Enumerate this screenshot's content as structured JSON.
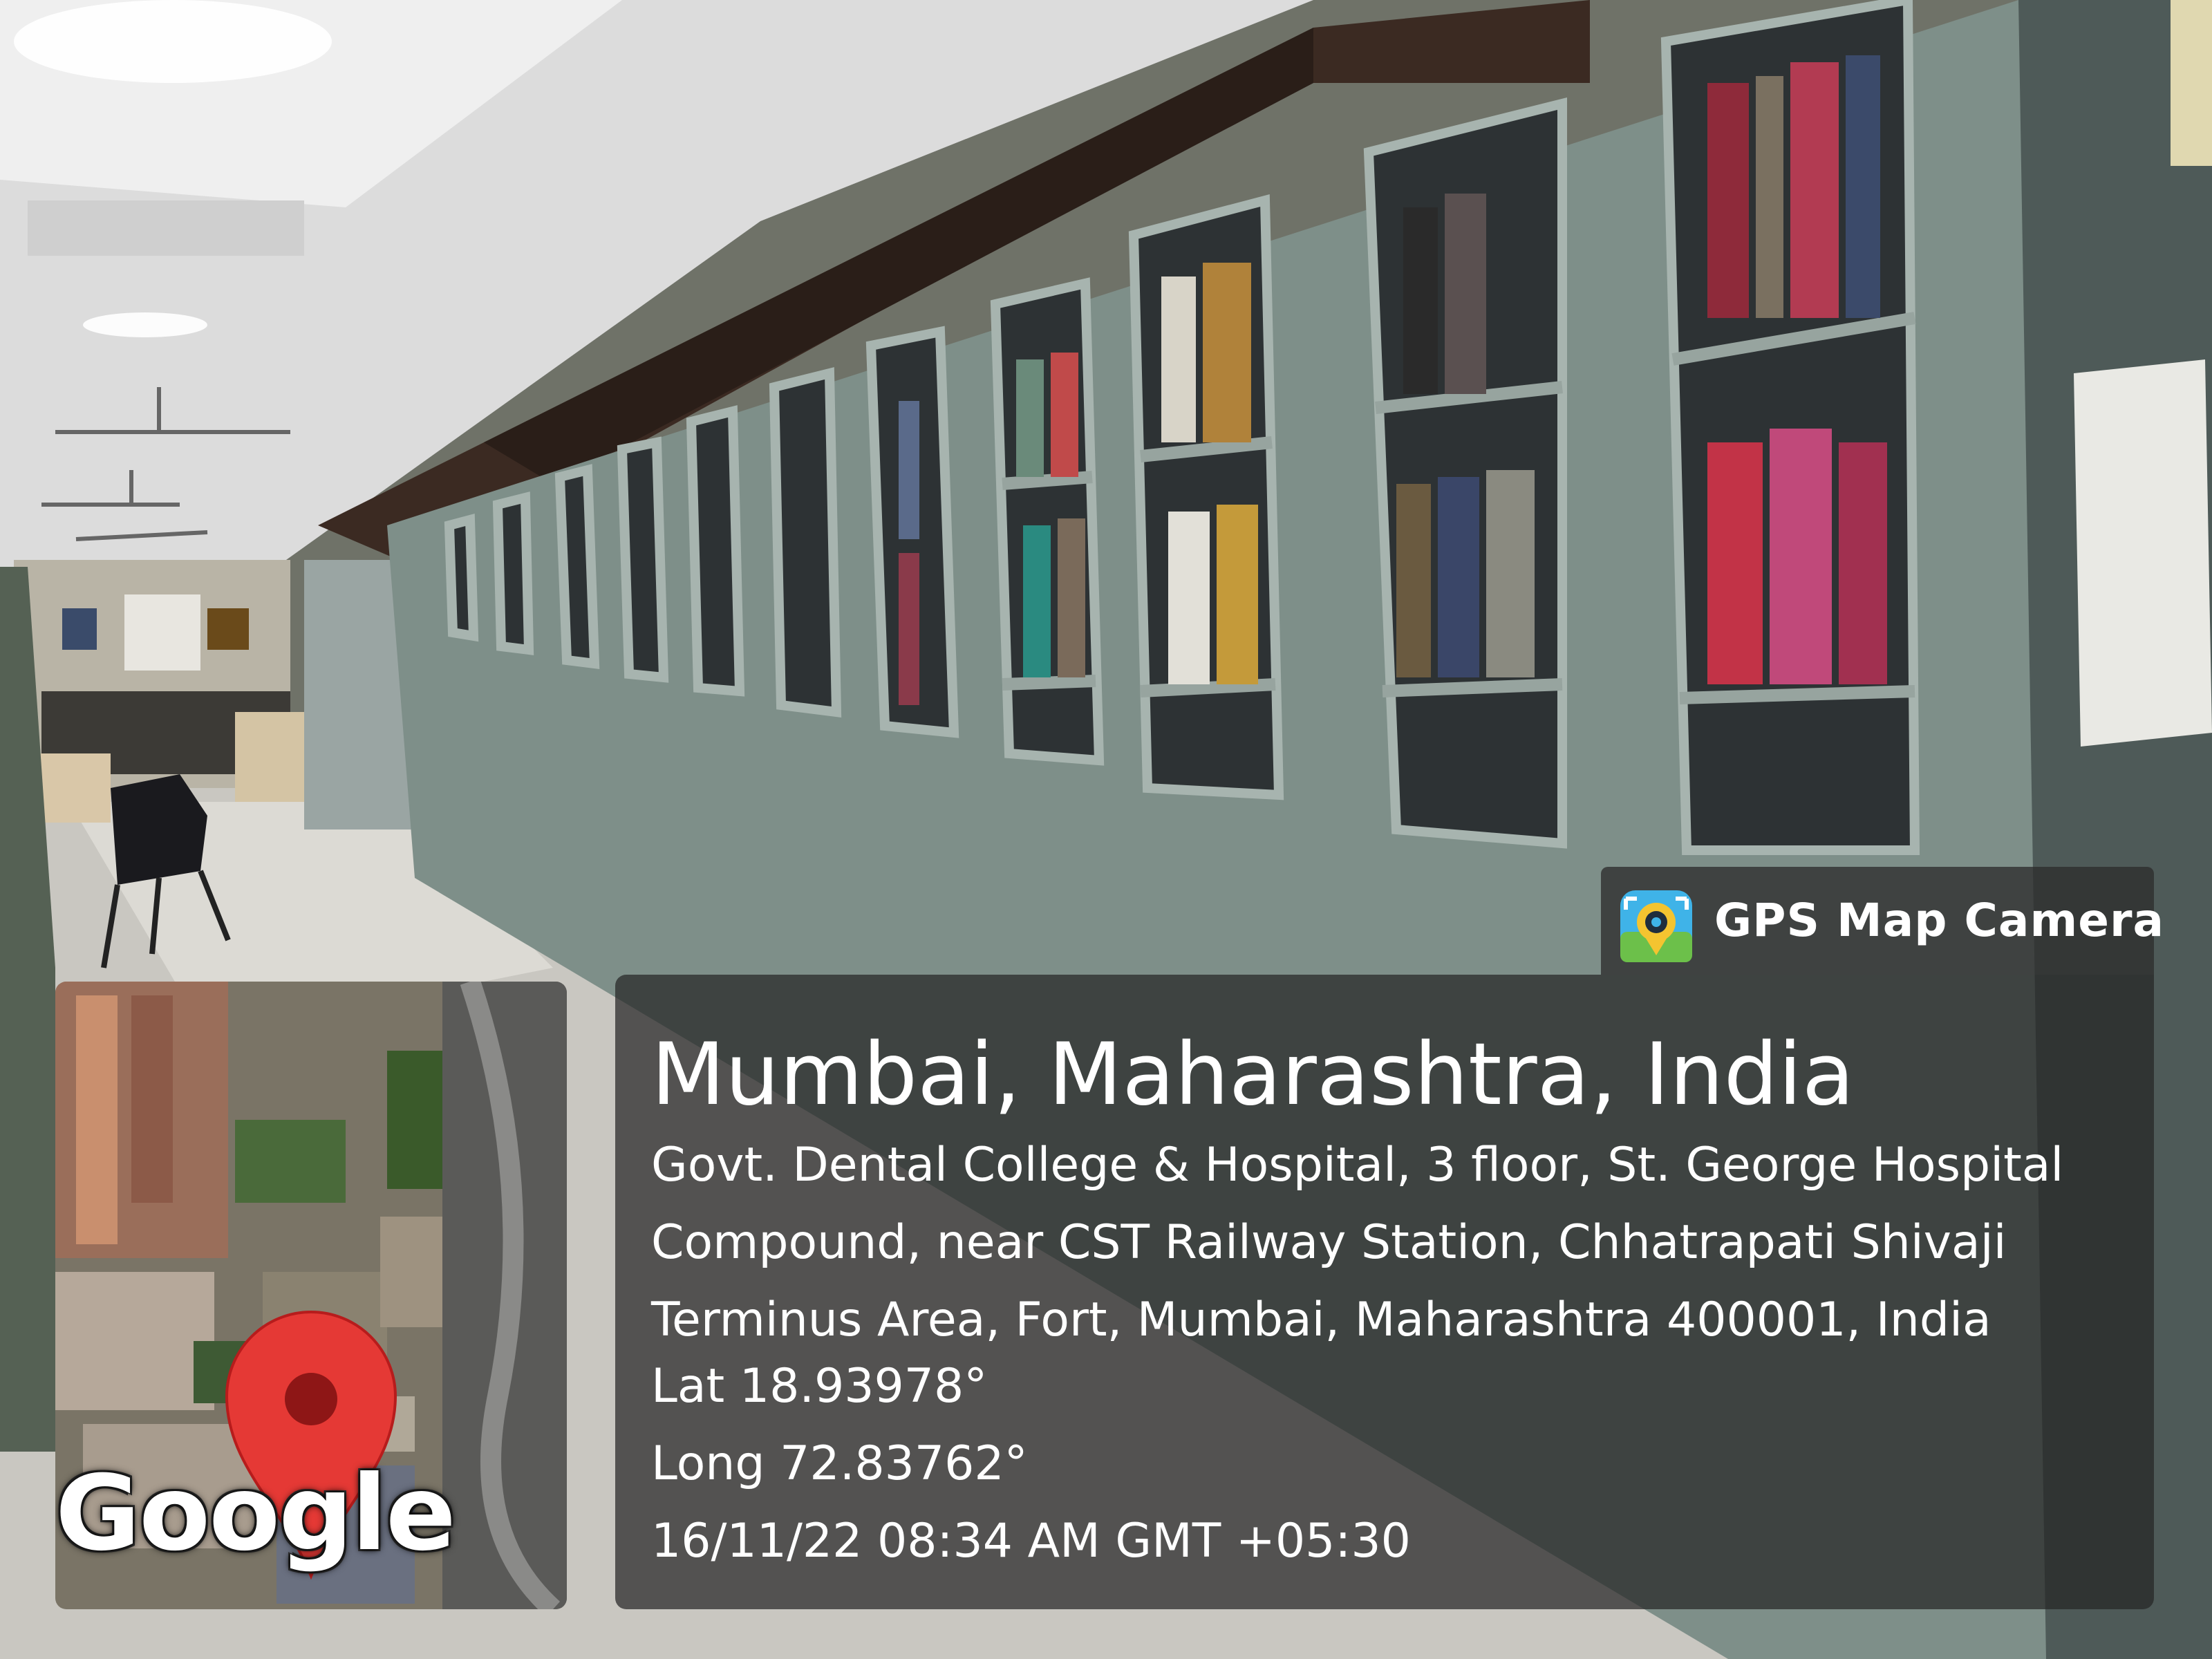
{
  "badge": {
    "label": "GPS Map Camera",
    "icon": "gps-map-camera-icon"
  },
  "location": {
    "title": "Mumbai, Maharashtra, India",
    "address": "Govt. Dental College & Hospital, 3 floor, St. George Hospital Compound, near CST Railway Station, Chhatrapati Shivaji Terminus Area, Fort, Mumbai, Maharashtra 400001, India",
    "lat": "Lat 18.93978°",
    "long": "Long 72.83762°",
    "datetime": "16/11/22 08:34 AM GMT +05:30"
  },
  "map": {
    "attribution": "Google",
    "marker_color": "#e53935"
  },
  "colors": {
    "panel": "#262626",
    "text": "#ffffff",
    "cabinet": "#8fa09a"
  }
}
